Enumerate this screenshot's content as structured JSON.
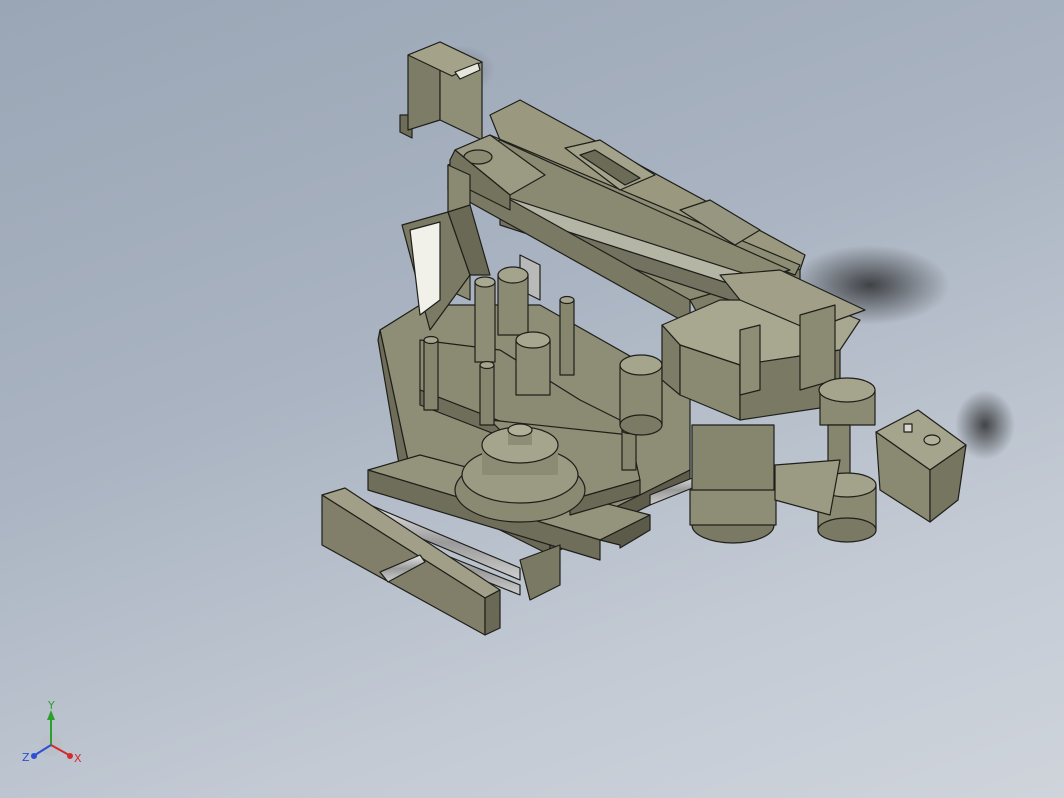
{
  "viewport": {
    "background_top": "#9aa6b6",
    "background_bottom": "#cfd4db",
    "model_color": "#8b8a72",
    "edge_color": "#1f1f1a"
  },
  "triad": {
    "x_label": "X",
    "y_label": "Y",
    "z_label": "Z",
    "x_color": "#d42a2a",
    "y_color": "#2ca02c",
    "z_color": "#2a4fd4"
  }
}
